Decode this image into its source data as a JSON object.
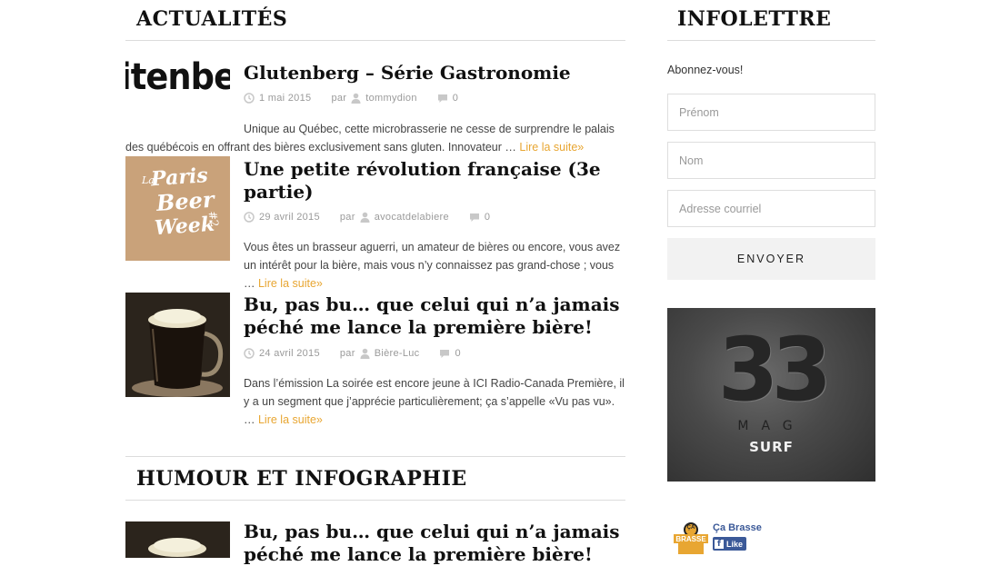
{
  "news": {
    "heading": "ACTUALITÉS",
    "posts": [
      {
        "title": "Glutenberg – Série Gastronomie",
        "date": "1 mai 2015",
        "by": "par",
        "author": "tommydion",
        "comments": "0",
        "excerpt": "Unique au Québec, cette microbrasserie ne cesse de surprendre le palais des québécois en offrant des bières exclusivement sans gluten. Innovateur … ",
        "more": "Lire la suite»",
        "thumb_text": "itenbe"
      },
      {
        "title": "Une petite révolution française (3e partie)",
        "date": "29 avril 2015",
        "by": "par",
        "author": "avocatdelabiere",
        "comments": "0",
        "excerpt": "Vous êtes un brasseur aguerri, un amateur de bières ou encore, vous avez un intérêt pour la bière, mais vous n’y connaissez pas grand-chose ; vous … ",
        "more": "Lire la suite»",
        "thumb_lines": [
          "Paris",
          "Beer",
          "Week"
        ],
        "thumb_small": "La",
        "thumb_num": "#2"
      },
      {
        "title": "Bu, pas bu… que celui qui n’a jamais péché me lance la première bière!",
        "date": "24 avril 2015",
        "by": "par",
        "author": "Bière-Luc",
        "comments": "0",
        "excerpt": "Dans l’émission La soirée est encore jeune à ICI Radio-Canada Première, il y a un segment que j’apprécie particulièrement; ça s’appelle «Vu pas vu». … ",
        "more": "Lire la suite»"
      }
    ]
  },
  "humour": {
    "heading": "HUMOUR ET INFOGRAPHIE",
    "post_title": "Bu, pas bu… que celui qui n’a jamais péché me lance la première bière!"
  },
  "sidebar": {
    "heading": "INFOLETTRE",
    "subscribe": "Abonnez-vous!",
    "first_name_placeholder": "Prénom",
    "last_name_placeholder": "Nom",
    "email_placeholder": "Adresse courriel",
    "submit": "ENVOYER",
    "ad": {
      "logo": "33",
      "line1": "MAG",
      "line2": "SURF"
    },
    "fb": {
      "page_name": "Ça Brasse",
      "like": "Like",
      "logo_text": "BRASSE",
      "logo_top": "ÇA"
    }
  },
  "colors": {
    "accent": "#e8a632",
    "rule": "#dcdcdc",
    "fb_blue": "#3b5998"
  },
  "icons": {
    "date": "clock-icon",
    "author": "user-icon",
    "comments": "comment-icon"
  }
}
